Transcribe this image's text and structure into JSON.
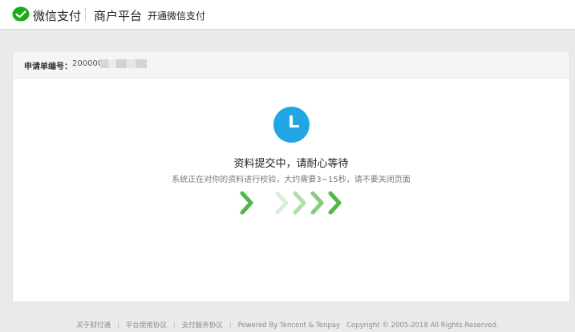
{
  "header": {
    "brand": "微信支付",
    "platform": "商户平台",
    "page_name": "开通微信支付"
  },
  "application": {
    "label": "申请单编号：",
    "value_visible": "200000"
  },
  "status": {
    "title": "资料提交中，请耐心等待",
    "subtitle": "系统正在对你的资料进行校验，大约需要3~15秒，请不要关闭页面",
    "accent_color": "#21a6e3",
    "progress_color": "#52b748"
  },
  "footer": {
    "link1": "关于财付通",
    "link2": "平台使用协议",
    "link3": "支付服务协议",
    "powered": "Powered By Tencent & Tenpay",
    "copyright": "Copyright © 2005-2018 All Rights Reserved."
  }
}
